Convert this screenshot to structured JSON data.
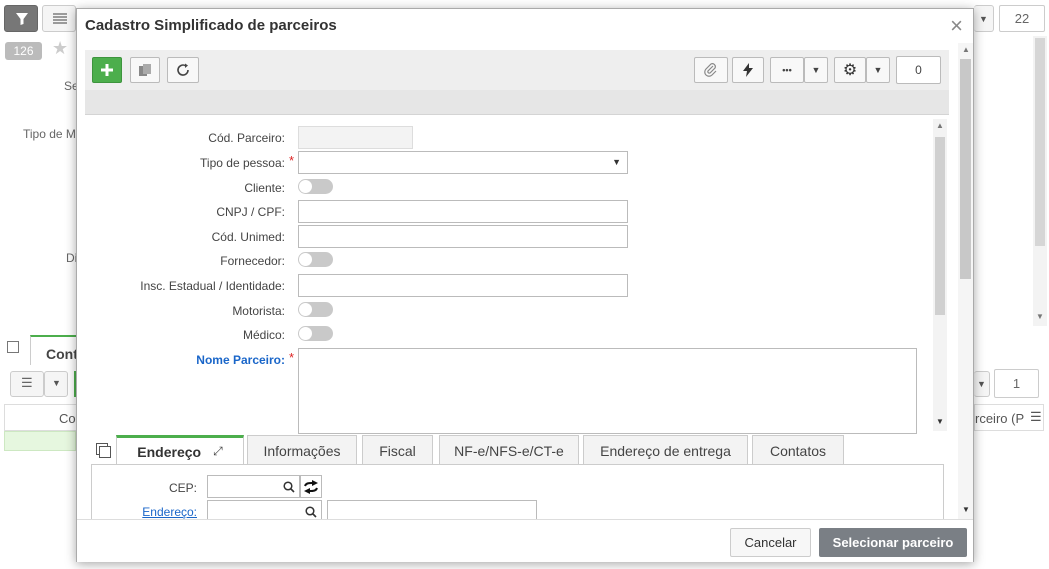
{
  "background": {
    "badge": "126",
    "counter_top": "22",
    "counter_mid": "1",
    "label_se": "Se",
    "label_tipo": "Tipo de M",
    "label_di": "Di",
    "tab_cont": "Cont",
    "col_co": "Co",
    "col_parceiro": "rceiro (P"
  },
  "modal": {
    "title": "Cadastro Simplificado de parceiros",
    "close": "×",
    "toolbar": {
      "more": "•••",
      "count": "0"
    },
    "fields": {
      "cod_parceiro": "Cód. Parceiro:",
      "tipo_pessoa": "Tipo de pessoa:",
      "cliente": "Cliente:",
      "cnpj_cpf": "CNPJ / CPF:",
      "cod_unimed": "Cód. Unimed:",
      "fornecedor": "Fornecedor:",
      "insc_estadual": "Insc. Estadual / Identidade:",
      "motorista": "Motorista:",
      "medico": "Médico:",
      "nome_parceiro": "Nome Parceiro:",
      "required_mark": "*"
    },
    "tabs": [
      {
        "label": "Endereço"
      },
      {
        "label": "Informações"
      },
      {
        "label": "Fiscal"
      },
      {
        "label": "NF-e/NFS-e/CT-e"
      },
      {
        "label": "Endereço de entrega"
      },
      {
        "label": "Contatos"
      }
    ],
    "address": {
      "cep": "CEP:",
      "endereco": "Endereço:"
    },
    "footer": {
      "cancel": "Cancelar",
      "select": "Selecionar parceiro"
    }
  },
  "colors": {
    "accent_green": "#4cae4c",
    "link_blue": "#1a66c9",
    "required_red": "#d22222",
    "primary_button": "#7a7f85"
  }
}
